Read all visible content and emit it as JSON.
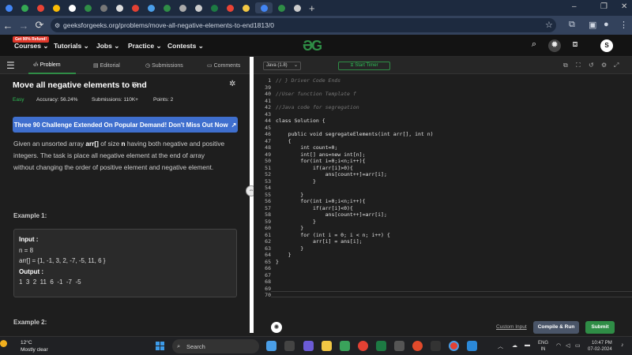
{
  "browser": {
    "url": "geeksforgeeks.org/problems/move-all-negative-elements-to-end1813/0"
  },
  "header": {
    "refund_badge": "Get 90% Refund!",
    "menu": [
      "Courses",
      "Tutorials",
      "Jobs",
      "Practice",
      "Contests"
    ],
    "avatar_letter": "S",
    "colors": {
      "brand": "#2f8d46"
    }
  },
  "left_panel": {
    "tabs": [
      "Problem",
      "Editorial",
      "Submissions",
      "Comments"
    ],
    "title": "Move all negative elements to end",
    "difficulty": "Easy",
    "accuracy": "Accuracy: 56.24%",
    "submissions": "Submissions: 110K+",
    "points": "Points: 2",
    "banner": "Three 90 Challenge Extended On Popular Demand! Don't Miss Out Now",
    "description": {
      "p1": "Given an unsorted array ",
      "arr": "arr[]",
      "p2": " of size ",
      "n": "n",
      "p3": " having both negative and positive integers. The task is place all negative element at the end of array without changing the order of positive element and negative element."
    },
    "example1": {
      "label": "Example 1:",
      "input_label": "Input :",
      "n_line": "n = 8",
      "arr_line": "arr[] = {1, -1, 3, 2, -7, -5, 11, 6 }",
      "output_label": "Output :",
      "output_line": "1  3  2  11  6  -1  -7  -5"
    },
    "example2_label": "Example 2:"
  },
  "editor": {
    "language": "Java (1.8)",
    "timer_label": "Start Timer",
    "lines": [
      {
        "n": "1",
        "t": "// } Driver Code Ends",
        "c": true
      },
      {
        "n": "39",
        "t": "",
        "c": false
      },
      {
        "n": "40",
        "t": "//User function Template f",
        "c": true
      },
      {
        "n": "41",
        "t": "",
        "c": false
      },
      {
        "n": "42",
        "t": "//Java code for segregation",
        "c": true
      },
      {
        "n": "43",
        "t": "",
        "c": false
      },
      {
        "n": "44",
        "t": "class Solution {",
        "c": false
      },
      {
        "n": "45",
        "t": "",
        "c": false
      },
      {
        "n": "46",
        "t": "    public void segregateElements(int arr[], int n)",
        "c": false
      },
      {
        "n": "47",
        "t": "    {",
        "c": false
      },
      {
        "n": "48",
        "t": "        int count=0;",
        "c": false
      },
      {
        "n": "49",
        "t": "        int[] ans=new int[n];",
        "c": false
      },
      {
        "n": "50",
        "t": "        for(int i=0;i<n;i++){",
        "c": false
      },
      {
        "n": "51",
        "t": "            if(arr[i]>0){",
        "c": false
      },
      {
        "n": "52",
        "t": "                ans[count++]=arr[i];",
        "c": false
      },
      {
        "n": "53",
        "t": "            }",
        "c": false
      },
      {
        "n": "54",
        "t": "",
        "c": false
      },
      {
        "n": "55",
        "t": "        }",
        "c": false
      },
      {
        "n": "56",
        "t": "        for(int i=0;i<n;i++){",
        "c": false
      },
      {
        "n": "57",
        "t": "            if(arr[i]<0){",
        "c": false
      },
      {
        "n": "58",
        "t": "                ans[count++]=arr[i];",
        "c": false
      },
      {
        "n": "59",
        "t": "            }",
        "c": false
      },
      {
        "n": "60",
        "t": "        }",
        "c": false
      },
      {
        "n": "61",
        "t": "        for (int i = 0; i < n; i++) {",
        "c": false
      },
      {
        "n": "62",
        "t": "            arr[i] = ans[i];",
        "c": false
      },
      {
        "n": "63",
        "t": "        }",
        "c": false
      },
      {
        "n": "64",
        "t": "    }",
        "c": false
      },
      {
        "n": "65",
        "t": "}",
        "c": false
      },
      {
        "n": "66",
        "t": "",
        "c": false
      },
      {
        "n": "67",
        "t": "",
        "c": false
      },
      {
        "n": "68",
        "t": "",
        "c": false
      },
      {
        "n": "69",
        "t": "",
        "c": false
      },
      {
        "n": "70",
        "t": "",
        "c": false
      }
    ],
    "custom_input": "Custom Input",
    "compile_label": "Compile & Run",
    "submit_label": "Submit"
  },
  "taskbar": {
    "temp": "12°C",
    "weather": "Mostly clear",
    "search": "Search",
    "lang_top": "ENG",
    "lang_bottom": "IN",
    "time": "10:47 PM",
    "date": "07-02-2024"
  }
}
